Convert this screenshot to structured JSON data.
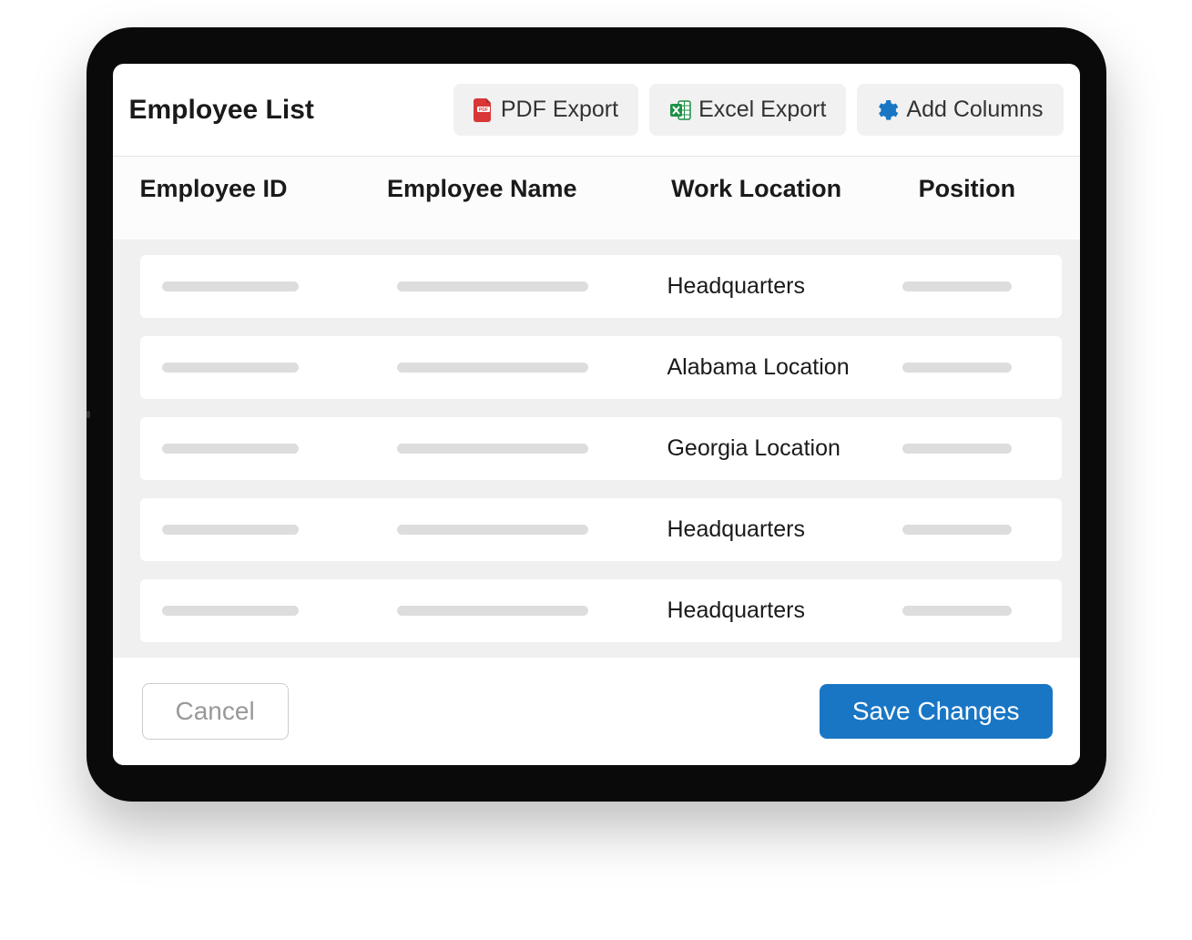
{
  "header": {
    "title": "Employee List",
    "actions": {
      "pdf_export": "PDF Export",
      "excel_export": "Excel Export",
      "add_columns": "Add Columns"
    }
  },
  "columns": {
    "employee_id": "Employee ID",
    "employee_name": "Employee Name",
    "work_location": "Work Location",
    "position": "Position"
  },
  "rows": [
    {
      "work_location": "Headquarters"
    },
    {
      "work_location": "Alabama Location"
    },
    {
      "work_location": "Georgia Location"
    },
    {
      "work_location": "Headquarters"
    },
    {
      "work_location": "Headquarters"
    }
  ],
  "footer": {
    "cancel": "Cancel",
    "save": "Save Changes"
  }
}
